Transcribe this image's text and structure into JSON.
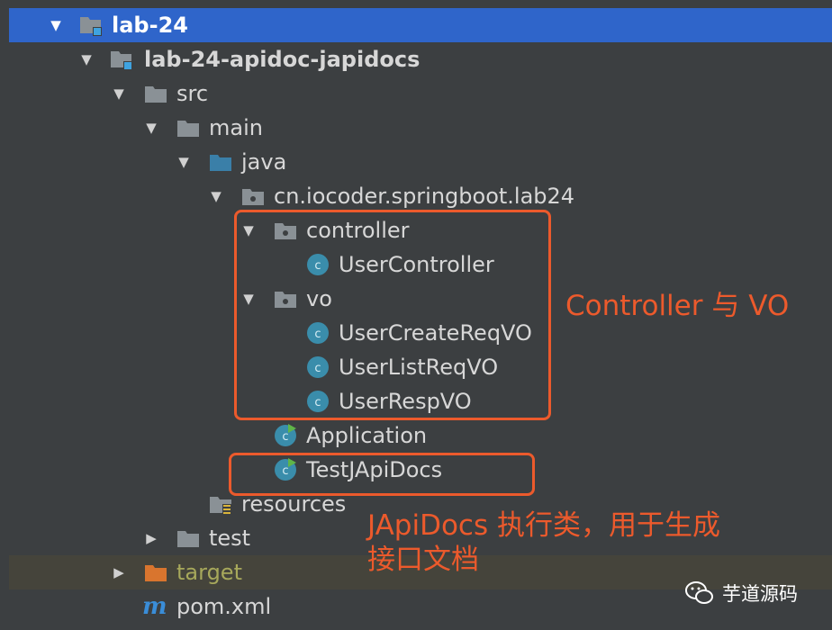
{
  "tree": {
    "root": "lab-24",
    "module": "lab-24-apidoc-japidocs",
    "src": "src",
    "main": "main",
    "java": "java",
    "package": "cn.iocoder.springboot.lab24",
    "controller_pkg": "controller",
    "user_controller": "UserController",
    "vo_pkg": "vo",
    "user_create_req_vo": "UserCreateReqVO",
    "user_list_req_vo": "UserListReqVO",
    "user_resp_vo": "UserRespVO",
    "application": "Application",
    "test_japidocs": "TestJApiDocs",
    "resources": "resources",
    "test": "test",
    "target": "target",
    "pom_icon": "m",
    "pom": "pom.xml"
  },
  "annotations": {
    "controller_vo": "Controller 与 VO",
    "japidocs_line1": "JApiDocs 执行类，用于生成",
    "japidocs_line2": "接口文档"
  },
  "watermark": {
    "text": "芋道源码",
    "icon": "wechat-icon"
  },
  "colors": {
    "background": "#3c3f41",
    "selection": "#2f65ca",
    "annotation": "#ec5a2c",
    "folder": "#8a9196",
    "source_folder": "#3a7fa8",
    "class_icon": "#3a8dab",
    "target_folder": "#d9752e"
  }
}
